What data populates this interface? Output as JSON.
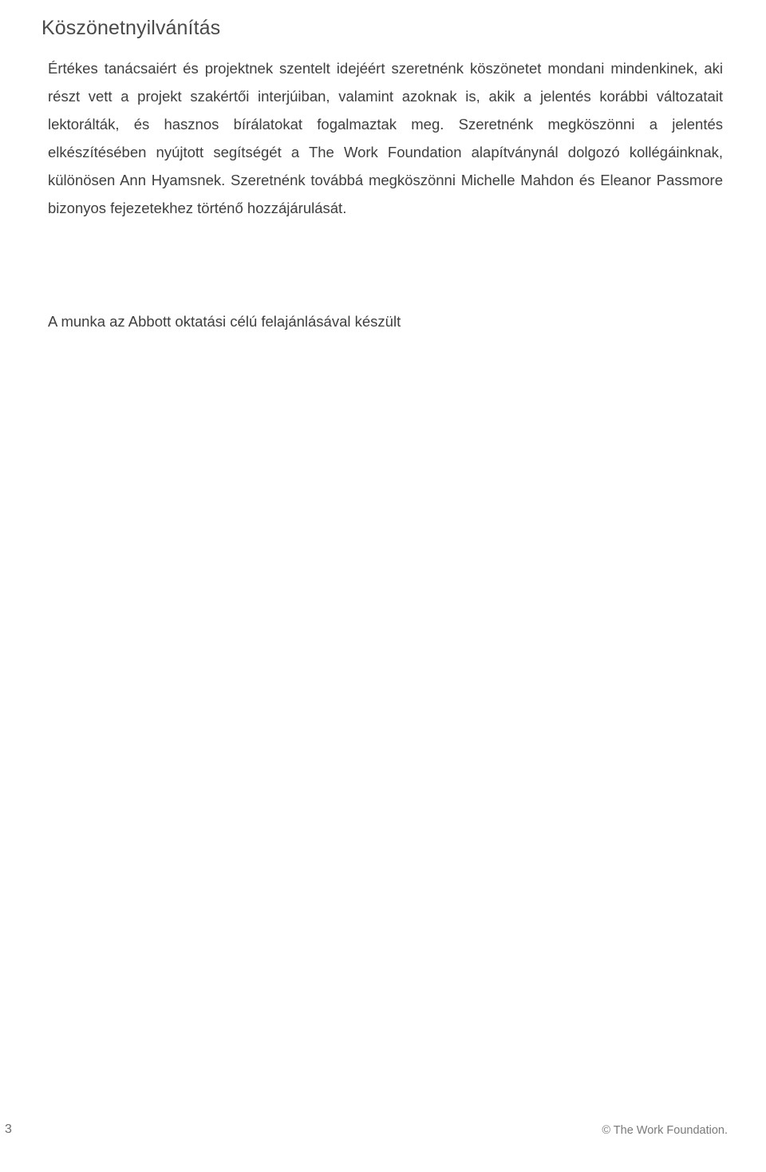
{
  "document": {
    "title": "Köszönetnyilvánítás",
    "acknowledgement_paragraph": "Értékes tanácsaiért és projektnek szentelt idejéért szeretnénk köszönetet mondani mindenkinek, aki részt vett a projekt szakértői interjúiban, valamint azoknak is, akik a jelentés korábbi változatait lektorálták, és hasznos bírálatokat fogalmaztak meg. Szeretnénk megköszönni a jelentés elkészítésében nyújtott segítségét a The Work Foundation alapítványnál dolgozó kollégáinknak, különösen Ann Hyamsnek. Szeretnénk továbbá megköszönni Michelle Mahdon és Eleanor Passmore bizonyos fejezetekhez történő hozzájárulását.",
    "funding_note": "A munka az Abbott oktatási célú felajánlásával készült",
    "footer": {
      "page_number": "3",
      "copyright": "© The Work Foundation."
    }
  }
}
